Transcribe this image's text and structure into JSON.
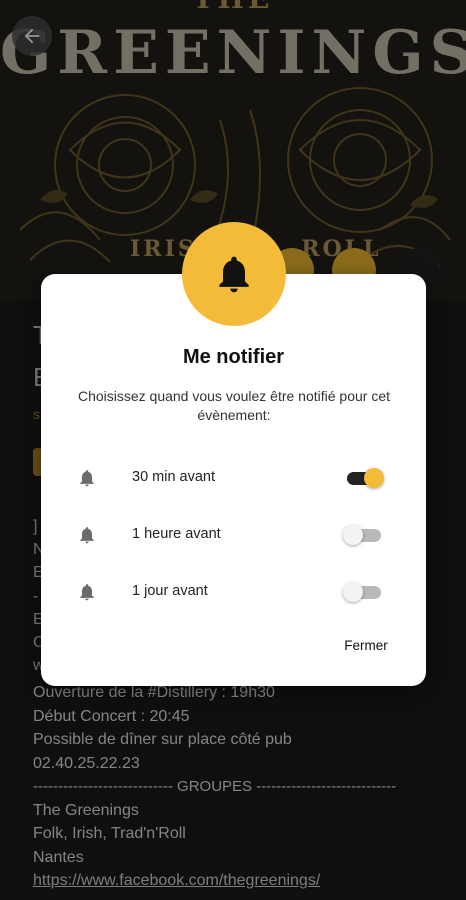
{
  "hero": {
    "the_text": "THE",
    "band_text": "GREENINGS",
    "subtitle_text": "IRISH",
    "subtitle_tail": "ROLL"
  },
  "background": {
    "title_fragment_1": "T",
    "title_fragment_2": "E",
    "meta_fragment": "s",
    "line_fragments": [
      "]",
      "N",
      "E",
      "-",
      "E",
      "C",
      "w"
    ]
  },
  "description": {
    "lines": [
      "Ouverture de la #Distillery : 19h30",
      "Début Concert : 20:45",
      "Possible de dîner sur place côté pub",
      "02.40.25.22.23",
      "---------------------------- GROUPES ----------------------------",
      "The Greenings",
      "Folk, Irish, Trad'n'Roll",
      "Nantes"
    ],
    "link": "https://www.facebook.com/thegreenings/"
  },
  "dialog": {
    "title": "Me notifier",
    "description": "Choisissez quand vous voulez être notifié pour cet évènement:",
    "options": [
      {
        "label": "30 min avant",
        "enabled": true
      },
      {
        "label": "1 heure avant",
        "enabled": false
      },
      {
        "label": "1 jour avant",
        "enabled": false
      }
    ],
    "close_label": "Fermer"
  },
  "colors": {
    "accent": "#f4bb38",
    "dark": "#1b1b19",
    "toggle_on_track": "#222222",
    "toggle_off_track": "#b9b9b9"
  },
  "icons": {
    "back": "arrow-left-icon",
    "bell": "bell-icon"
  }
}
